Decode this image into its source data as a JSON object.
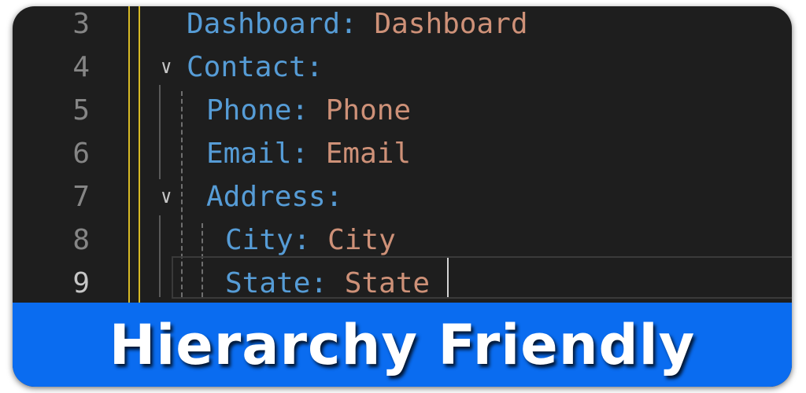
{
  "editor": {
    "line_numbers": [
      "3",
      "4",
      "5",
      "6",
      "7",
      "8",
      "9"
    ],
    "active_line": "9",
    "lines": [
      {
        "key": "Dashboard",
        "sep": ": ",
        "value": "Dashboard"
      },
      {
        "key": "Contact",
        "sep": ":",
        "value": ""
      },
      {
        "key": "Phone",
        "sep": ": ",
        "value": "Phone"
      },
      {
        "key": "Email",
        "sep": ": ",
        "value": "Email"
      },
      {
        "key": "Address",
        "sep": ":",
        "value": ""
      },
      {
        "key": "City",
        "sep": ": ",
        "value": "City"
      },
      {
        "key": "State",
        "sep": ": ",
        "value": "State"
      }
    ],
    "fold_icon": "chevron-down-icon"
  },
  "banner": {
    "title": "Hierarchy Friendly"
  },
  "colors": {
    "background": "#1e1e1e",
    "key": "#569cd6",
    "value": "#ce9178",
    "line_number": "#858585",
    "indent_guide_active": "#d7ba25",
    "banner": "#0a6cf0"
  }
}
